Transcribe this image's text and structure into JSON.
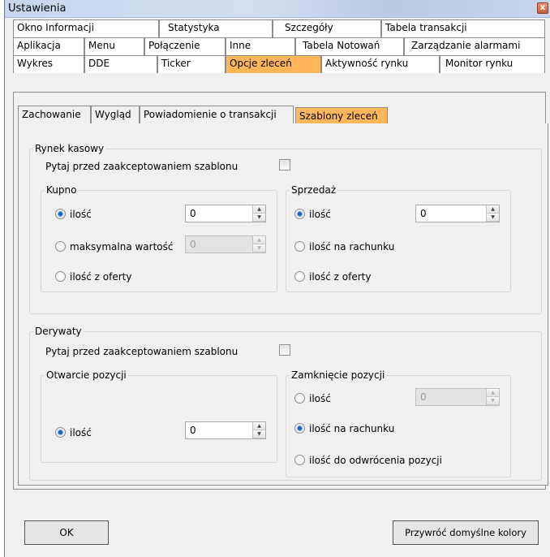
{
  "window": {
    "title": "Ustawienia",
    "close_glyph": "x"
  },
  "tabs": {
    "row1": [
      "Okno Informacji",
      "Statystyka",
      "Szczegóły",
      "Tabela transakcji"
    ],
    "row2": [
      "Aplikacja",
      "Menu",
      "Połączenie",
      "Inne",
      "Tabela Notowań",
      "Zarządzanie alarmami"
    ],
    "row3": [
      "Wykres",
      "DDE",
      "Ticker",
      "Opcje zleceń",
      "Aktywność rynku",
      "Monitor rynku"
    ],
    "selected": "Opcje zleceń"
  },
  "subtabs": {
    "items": [
      "Zachowanie",
      "Wygląd",
      "Powiadomienie o transakcji",
      "Szablony zleceń"
    ],
    "selected": "Szablony zleceń"
  },
  "cash": {
    "title": "Rynek kasowy",
    "confirm_label": "Pytaj przed zaakceptowaniem szablonu",
    "confirm_checked": false,
    "buy": {
      "title": "Kupno",
      "opt_qty": "ilość",
      "qty_value": "0",
      "opt_max": "maksymalna wartość",
      "max_value": "0",
      "opt_offer": "ilość z oferty",
      "selected": "ilość"
    },
    "sell": {
      "title": "Sprzedaż",
      "opt_qty": "ilość",
      "qty_value": "0",
      "opt_account": "ilość na rachunku",
      "opt_offer": "ilość z oferty",
      "selected": "ilość"
    }
  },
  "derivatives": {
    "title": "Derywaty",
    "confirm_label": "Pytaj przed zaakceptowaniem szablonu",
    "confirm_checked": false,
    "open": {
      "title": "Otwarcie pozycji",
      "opt_qty": "ilość",
      "qty_value": "0",
      "selected": "ilość"
    },
    "close": {
      "title": "Zamknięcie pozycji",
      "opt_qty": "ilość",
      "qty_value": "0",
      "opt_account": "ilość na rachunku",
      "opt_reverse": "ilość do odwrócenia pozycji",
      "selected": "ilość na rachunku"
    }
  },
  "buttons": {
    "ok": "OK",
    "restore": "Przywróć domyślne kolory"
  },
  "colors": {
    "selected_tab": "#ffb75a",
    "radio_selected": "#1c5fc1"
  }
}
